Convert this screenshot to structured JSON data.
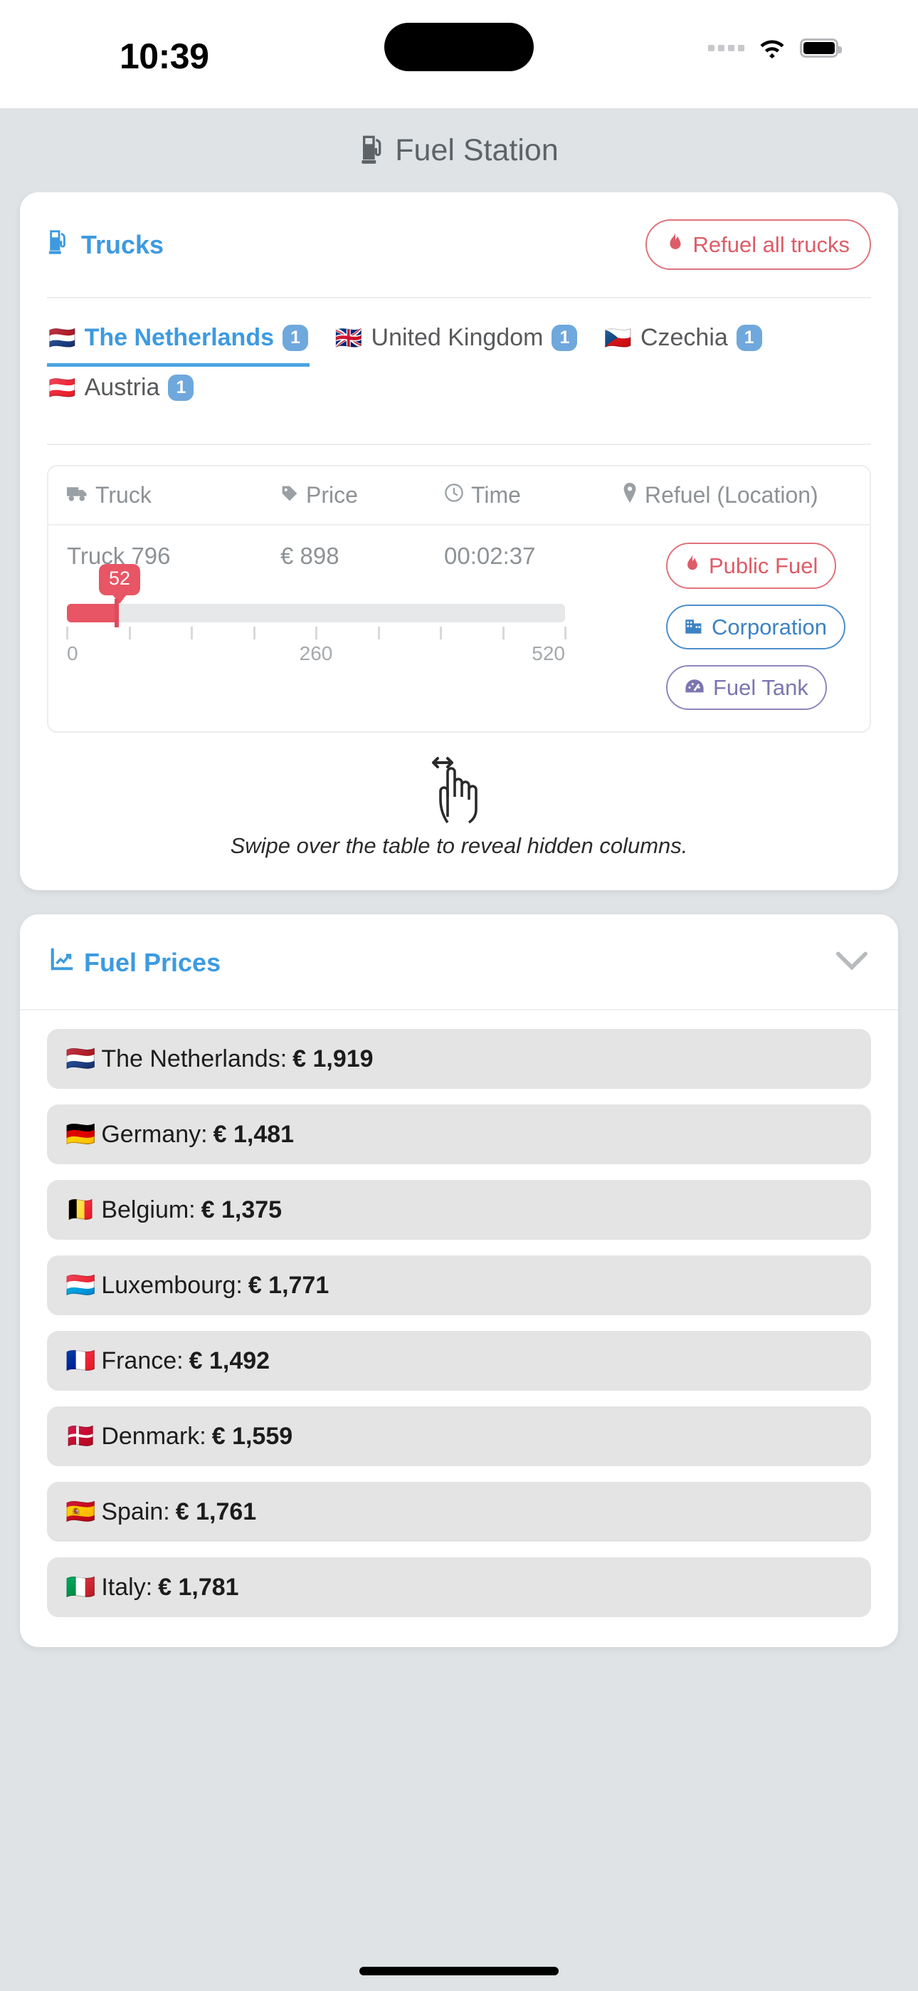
{
  "status_bar": {
    "time": "10:39",
    "signal_icon": "signal-dots-icon",
    "wifi_icon": "wifi-icon",
    "battery_icon": "battery-icon"
  },
  "header": {
    "title": "Fuel Station",
    "icon": "fuel-pump-icon"
  },
  "trucks_card": {
    "title": "Trucks",
    "title_icon": "fuel-pump-icon",
    "refuel_all_label": "Refuel all trucks",
    "refuel_all_icon": "flame-icon",
    "tabs": [
      {
        "flag": "🇳🇱",
        "label": "The Netherlands",
        "count": "1",
        "active": true
      },
      {
        "flag": "🇬🇧",
        "label": "United Kingdom",
        "count": "1",
        "active": false
      },
      {
        "flag": "🇨🇿",
        "label": "Czechia",
        "count": "1",
        "active": false
      },
      {
        "flag": "🇦🇹",
        "label": "Austria",
        "count": "1",
        "active": false
      }
    ],
    "table": {
      "columns": [
        {
          "label": "Truck",
          "icon": "truck-icon"
        },
        {
          "label": "Price",
          "icon": "price-tag-icon"
        },
        {
          "label": "Time",
          "icon": "clock-icon"
        },
        {
          "label": "Refuel (Location)",
          "icon": "map-pin-icon"
        }
      ],
      "row": {
        "truck": "Truck 796",
        "price": "€ 898",
        "time": "00:02:37",
        "actions": [
          {
            "label": "Public Fuel",
            "icon": "flame-icon",
            "style": "red"
          },
          {
            "label": "Corporation",
            "icon": "building-icon",
            "style": "blue"
          },
          {
            "label": "Fuel Tank",
            "icon": "gauge-icon",
            "style": "purple"
          }
        ],
        "slider": {
          "value": "52",
          "min": "0",
          "mid": "260",
          "max": "520",
          "value_number": 52,
          "max_number": 520,
          "tick_count": 9
        }
      }
    },
    "swipe_hint": {
      "icon": "swipe-hand-icon",
      "text": "Swipe over the table to reveal hidden columns."
    }
  },
  "fuel_prices_card": {
    "title": "Fuel Prices",
    "title_icon": "chart-line-icon",
    "collapse_icon": "chevron-down-icon",
    "items": [
      {
        "flag": "🇳🇱",
        "country": "The Netherlands:",
        "price": "€ 1,919"
      },
      {
        "flag": "🇩🇪",
        "country": "Germany:",
        "price": "€ 1,481"
      },
      {
        "flag": "🇧🇪",
        "country": "Belgium:",
        "price": "€ 1,375"
      },
      {
        "flag": "🇱🇺",
        "country": "Luxembourg:",
        "price": "€ 1,771"
      },
      {
        "flag": "🇫🇷",
        "country": "France:",
        "price": "€ 1,492"
      },
      {
        "flag": "🇩🇰",
        "country": "Denmark:",
        "price": "€ 1,559"
      },
      {
        "flag": "🇪🇸",
        "country": "Spain:",
        "price": "€ 1,761"
      },
      {
        "flag": "🇮🇹",
        "country": "Italy:",
        "price": "€ 1,781"
      }
    ]
  },
  "colors": {
    "accent_blue": "#3d9ae0",
    "accent_red": "#e85565",
    "accent_purple": "#7b76b0",
    "page_background": "#dfe3e6",
    "badge_blue": "#6fa8dc"
  }
}
